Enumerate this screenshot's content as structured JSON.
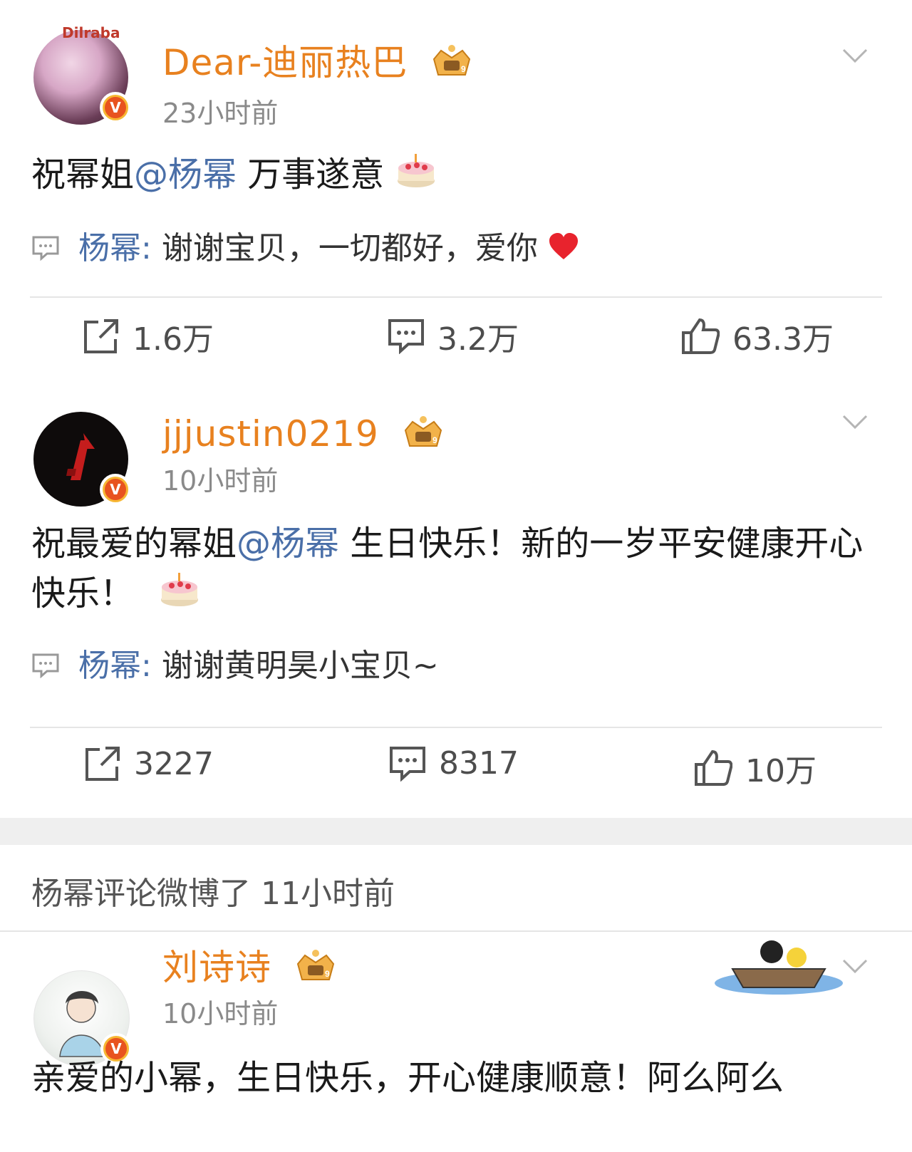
{
  "posts": [
    {
      "username": "Dear-迪丽热巴",
      "time": "23小时前",
      "content_prefix": "祝幂姐",
      "mention": "@杨幂",
      "content_suffix": "  万事遂意",
      "reply_author": "杨幂:",
      "reply_text": " 谢谢宝贝，一切都好，爱你",
      "reposts": "1.6万",
      "comments": "3.2万",
      "likes": "63.3万",
      "avatar_text": "Dilraba"
    },
    {
      "username": "jjjustin0219",
      "time": "10小时前",
      "content_prefix": "祝最爱的幂姐",
      "mention": "@杨幂",
      "content_suffix": " 生日快乐！新的一岁平安健康开心快乐！",
      "reply_author": "杨幂:",
      "reply_text": " 谢谢黄明昊小宝贝~",
      "reposts": "3227",
      "comments": "8317",
      "likes": "10万"
    }
  ],
  "section_label": "杨幂评论微博了 11小时前",
  "third_post": {
    "username": "刘诗诗",
    "time": "10小时前",
    "content": "亲爱的小幂，生日快乐，开心健康顺意！阿么阿么"
  },
  "colors": {
    "username": "#e8811f",
    "mention": "#4a6fa8",
    "divider": "#e5e5e5",
    "band": "#efefef"
  }
}
